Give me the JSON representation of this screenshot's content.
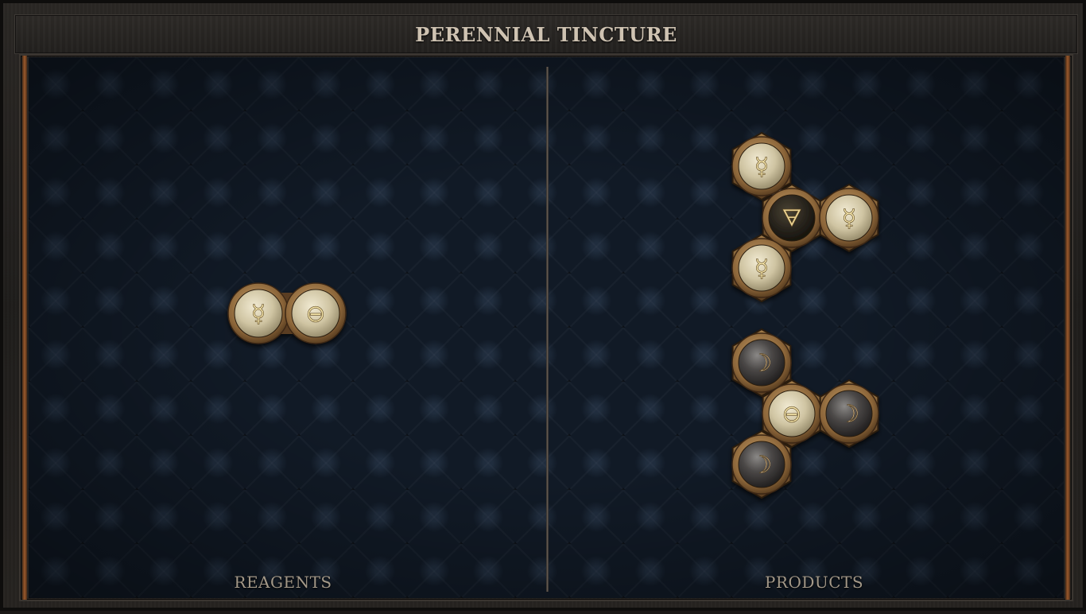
{
  "title": "PERENNIAL TINCTURE",
  "panels": {
    "reagents_label": "REAGENTS",
    "products_label": "PRODUCTS"
  },
  "colors": {
    "bone_atom": "#d7ceb0",
    "dark_atom": "#2a2620",
    "silver_atom": "#4a4848",
    "brass": "#8a6a40",
    "glyph_light": "#f4e4a8",
    "glyph_dark": "#e8d090"
  },
  "reagents": [
    {
      "name": "reagent-molecule",
      "atoms": [
        {
          "element": "quicksilver",
          "glyph": "☿",
          "style": "bone"
        },
        {
          "element": "salt",
          "glyph": "⊖",
          "style": "bone"
        }
      ],
      "bonds": [
        [
          0,
          1
        ]
      ]
    }
  ],
  "products": [
    {
      "name": "product-molecule-1",
      "atoms": [
        {
          "element": "quicksilver",
          "glyph": "☿",
          "style": "bone"
        },
        {
          "element": "quintessence",
          "glyph": "🜃",
          "style": "dark"
        },
        {
          "element": "quicksilver",
          "glyph": "☿",
          "style": "bone"
        },
        {
          "element": "quicksilver",
          "glyph": "☿",
          "style": "bone"
        }
      ],
      "bonds": [
        [
          0,
          1
        ],
        [
          1,
          2
        ],
        [
          1,
          3
        ]
      ]
    },
    {
      "name": "product-molecule-2",
      "atoms": [
        {
          "element": "silver",
          "glyph": "☽",
          "style": "silver"
        },
        {
          "element": "salt",
          "glyph": "⊖",
          "style": "bone"
        },
        {
          "element": "silver",
          "glyph": "☽",
          "style": "silver"
        },
        {
          "element": "silver",
          "glyph": "☽",
          "style": "silver"
        }
      ],
      "bonds": [
        [
          0,
          1
        ],
        [
          1,
          2
        ],
        [
          1,
          3
        ]
      ]
    }
  ]
}
